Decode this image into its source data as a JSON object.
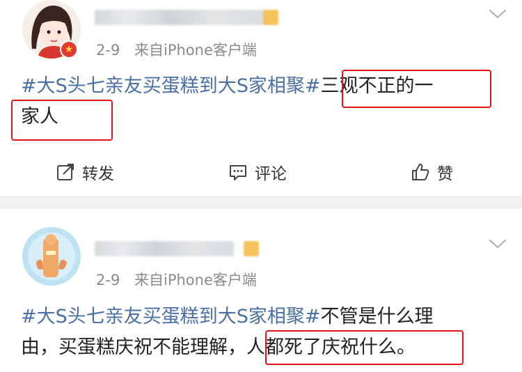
{
  "posts": [
    {
      "timestamp": "2-9",
      "source": "来自iPhone客户端",
      "topic": "#大S头七亲友买蛋糕到大S家相聚#",
      "text": "三观不正的一家人",
      "line1_tail": "三观不正的一",
      "line2": "家人"
    },
    {
      "timestamp": "2-9",
      "source": "来自iPhone客户端",
      "topic": "#大S头七亲友买蛋糕到大S家相聚#",
      "line1_tail": "不管是什么理",
      "line2_a": "由，买蛋糕庆祝不能理解，",
      "line2_b": "人都死了庆祝什么。"
    }
  ],
  "actions": {
    "repost_label": "转发",
    "comment_label": "评论",
    "like_label": "赞"
  },
  "colors": {
    "topic": "#4a6fa5",
    "highlight_box": "#e0121a",
    "meta_text": "#8a8a8a"
  }
}
